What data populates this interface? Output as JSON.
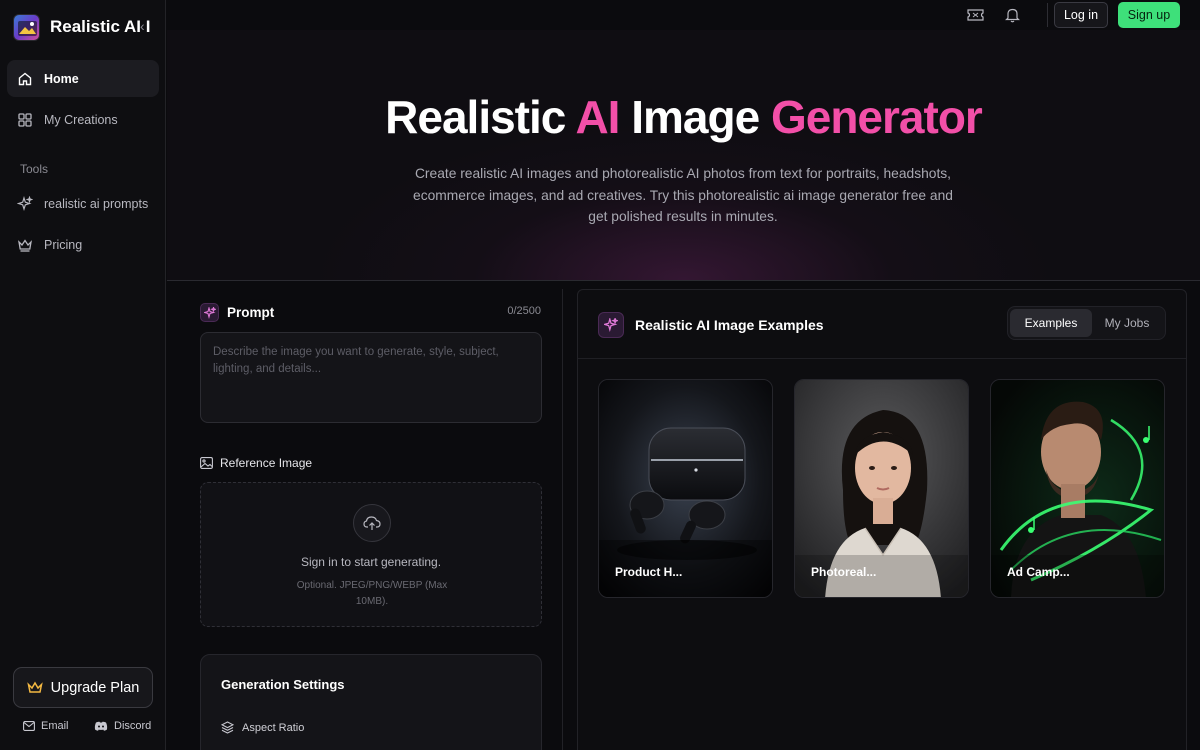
{
  "app": {
    "name": "Realistic AI I",
    "collapse_glyph": "‹"
  },
  "sidebar": {
    "items": [
      {
        "label": "Home",
        "icon": "home-icon",
        "active": true
      },
      {
        "label": "My Creations",
        "icon": "grid-icon",
        "active": false
      }
    ],
    "tools_label": "Tools",
    "tools": [
      {
        "label": "realistic ai prompts",
        "icon": "sparkle-icon"
      },
      {
        "label": "Pricing",
        "icon": "crown-icon"
      }
    ],
    "upgrade_label": "Upgrade Plan",
    "footer": {
      "email": "Email",
      "discord": "Discord"
    }
  },
  "header": {
    "login": "Log in",
    "signup": "Sign up",
    "accent": "#3ee07a"
  },
  "hero": {
    "title_parts": [
      "Realistic ",
      "AI",
      " Image ",
      "Generator"
    ],
    "subtitle": "Create realistic AI images and photorealistic AI photos from text for portraits, headshots, ecommerce images, and ad creatives. Try this photorealistic ai image generator free and get polished results in minutes.",
    "accent": "#f24fa8"
  },
  "prompt": {
    "label": "Prompt",
    "counter": "0/2500",
    "placeholder": "Describe the image you want to generate, style, subject, lighting, and details..."
  },
  "reference": {
    "label": "Reference Image",
    "title": "Sign in to start generating.",
    "hint": "Optional. JPEG/PNG/WEBP (Max 10MB)."
  },
  "settings": {
    "title": "Generation Settings",
    "aspect_label": "Aspect Ratio"
  },
  "examples": {
    "title": "Realistic AI Image Examples",
    "tabs": [
      "Examples",
      "My Jobs"
    ],
    "cards": [
      {
        "label": "Product H..."
      },
      {
        "label": "Photoreal..."
      },
      {
        "label": "Ad Camp..."
      }
    ]
  }
}
